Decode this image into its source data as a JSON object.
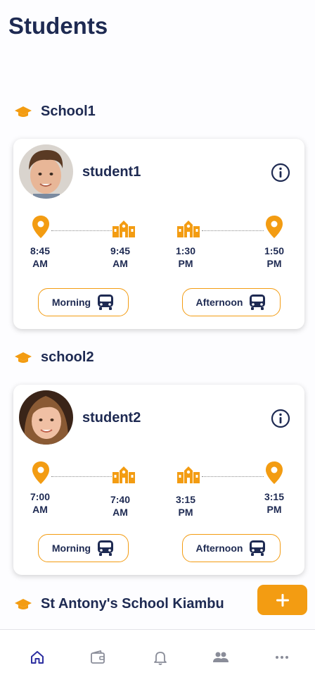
{
  "header": {
    "title": "Students"
  },
  "colors": {
    "accent": "#f39c12",
    "navy": "#1e2a52",
    "nav_inactive": "#8a8d99",
    "nav_active": "#2d2fa0"
  },
  "schools": [
    {
      "name": "School1",
      "student": {
        "name": "student1",
        "avatar_icon": "boy-avatar",
        "morning": {
          "pickup_time": "8:45 AM",
          "school_time": "9:45 AM"
        },
        "afternoon": {
          "school_time": "1:30 PM",
          "dropoff_time": "1:50 PM"
        },
        "times": [
          {
            "time": "8:45",
            "period": "AM"
          },
          {
            "time": "9:45",
            "period": "AM"
          },
          {
            "time": "1:30",
            "period": "PM"
          },
          {
            "time": "1:50",
            "period": "PM"
          }
        ],
        "morning_label": "Morning",
        "afternoon_label": "Afternoon"
      }
    },
    {
      "name": "school2",
      "student": {
        "name": "student2",
        "avatar_icon": "girl-avatar",
        "times": [
          {
            "time": "7:00",
            "period": "AM"
          },
          {
            "time": "7:40",
            "period": "AM"
          },
          {
            "time": "3:15",
            "period": "PM"
          },
          {
            "time": "3:15",
            "period": "PM"
          }
        ],
        "morning_label": "Morning",
        "afternoon_label": "Afternoon"
      }
    },
    {
      "name": "St Antony's School Kiambu"
    }
  ],
  "fab": {
    "icon": "plus-icon"
  },
  "bottom_nav": [
    {
      "icon": "home-icon",
      "active": true
    },
    {
      "icon": "wallet-icon",
      "active": false
    },
    {
      "icon": "bell-icon",
      "active": false
    },
    {
      "icon": "people-icon",
      "active": false
    },
    {
      "icon": "more-icon",
      "active": false
    }
  ]
}
